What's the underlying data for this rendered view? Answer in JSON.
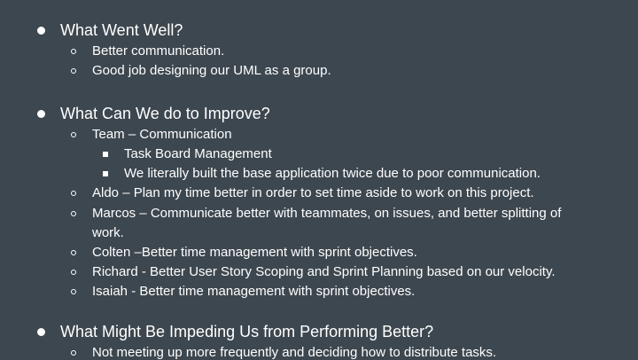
{
  "sections": [
    {
      "heading": "What Went Well?",
      "items": [
        "Better communication.",
        "Good job designing our UML as a group."
      ]
    },
    {
      "heading": "What Can We do to Improve?",
      "items": [
        "Team – Communication",
        "Task Board Management",
        "We literally built the base application twice due to poor communication.",
        "Aldo – Plan my time better in order to set time aside to work on this project.",
        "Marcos – Communicate better with teammates, on issues, and better splitting of",
        "work.",
        "Colten –Better time management with sprint objectives.",
        "Richard - Better User Story Scoping and Sprint Planning based on our velocity.",
        "Isaiah - Better time management with sprint objectives."
      ]
    },
    {
      "heading": "What Might Be Impeding Us from Performing Better?",
      "items": [
        "Not meeting up more frequently and deciding how to distribute tasks."
      ]
    }
  ]
}
